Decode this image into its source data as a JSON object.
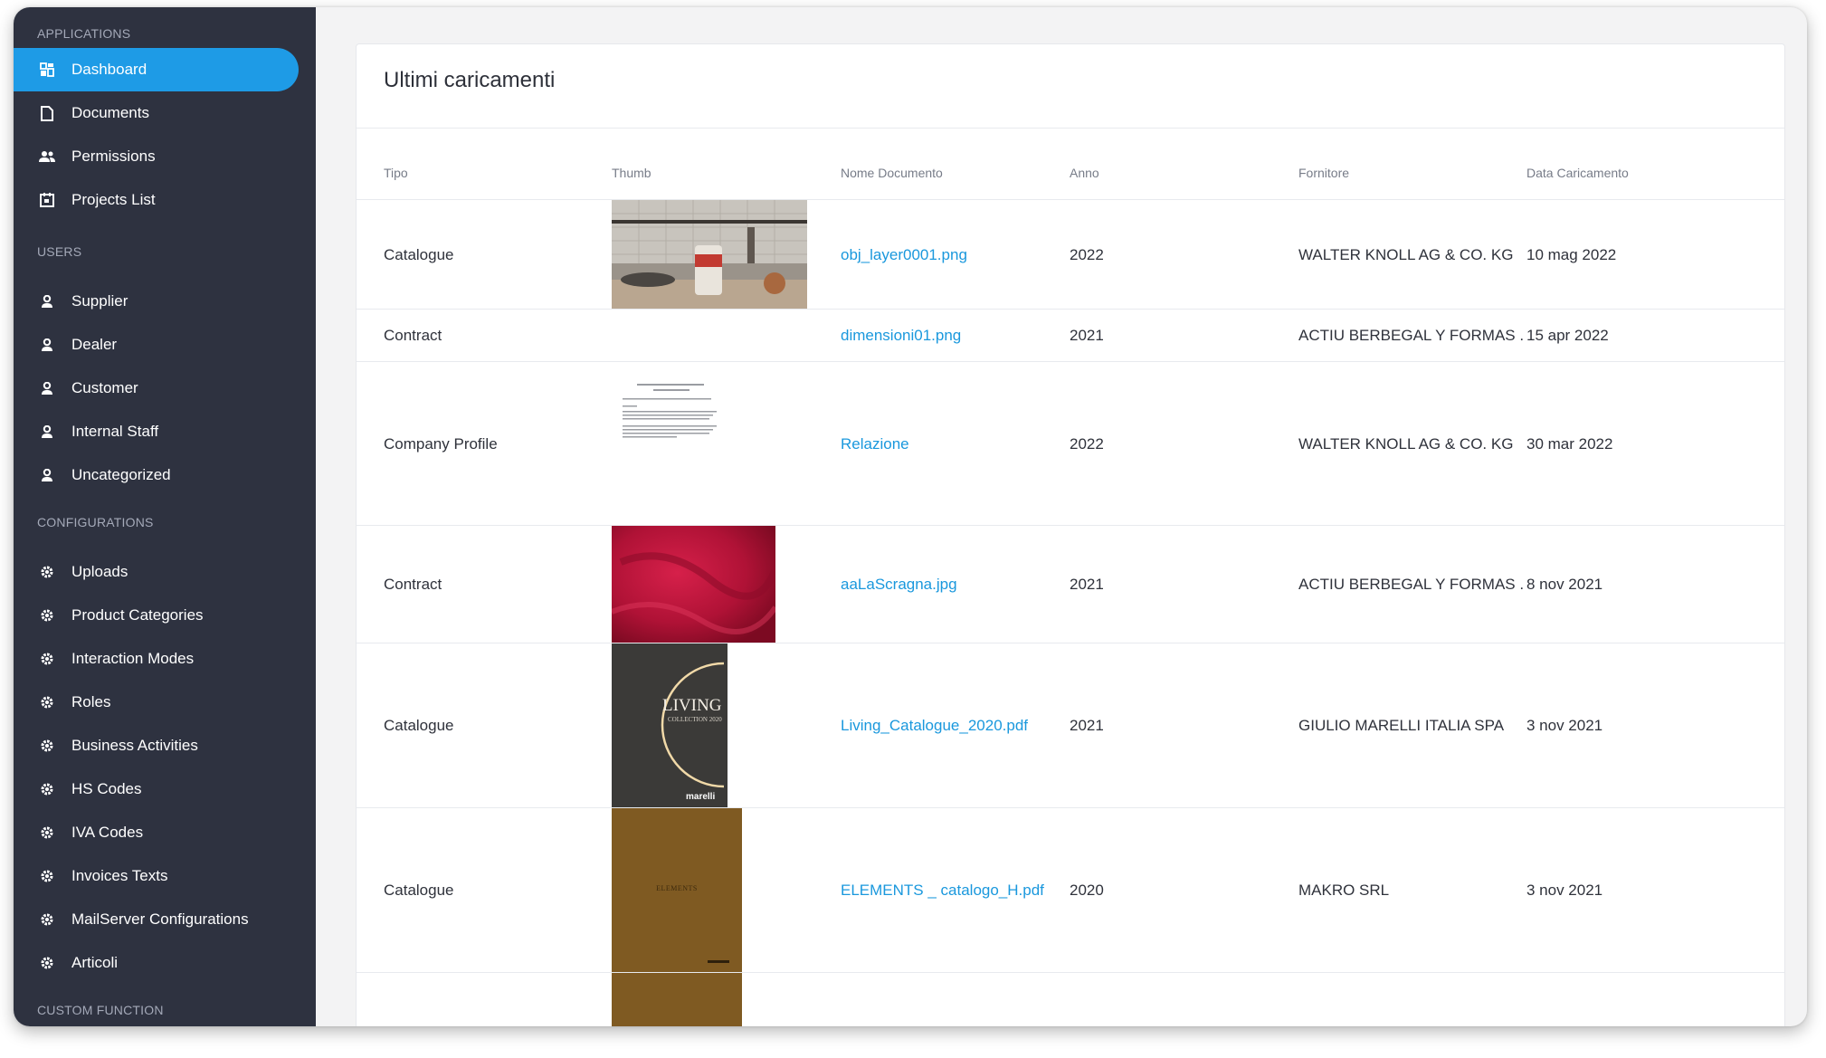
{
  "sidebar": {
    "sections": [
      {
        "title": "APPLICATIONS",
        "items": [
          {
            "label": "Dashboard",
            "icon": "dashboard-icon",
            "active": true
          },
          {
            "label": "Documents",
            "icon": "document-icon"
          },
          {
            "label": "Permissions",
            "icon": "users-icon"
          },
          {
            "label": "Projects List",
            "icon": "calendar-icon"
          }
        ]
      },
      {
        "title": "USERS",
        "items": [
          {
            "label": "Supplier",
            "icon": "user-icon"
          },
          {
            "label": "Dealer",
            "icon": "user-icon"
          },
          {
            "label": "Customer",
            "icon": "user-icon"
          },
          {
            "label": "Internal Staff",
            "icon": "user-icon"
          },
          {
            "label": "Uncategorized",
            "icon": "user-icon"
          }
        ]
      },
      {
        "title": "CONFIGURATIONS",
        "items": [
          {
            "label": "Uploads",
            "icon": "gear-icon"
          },
          {
            "label": "Product Categories",
            "icon": "gear-icon"
          },
          {
            "label": "Interaction Modes",
            "icon": "gear-icon"
          },
          {
            "label": "Roles",
            "icon": "gear-icon"
          },
          {
            "label": "Business Activities",
            "icon": "gear-icon"
          },
          {
            "label": "HS Codes",
            "icon": "gear-icon"
          },
          {
            "label": "IVA Codes",
            "icon": "gear-icon"
          },
          {
            "label": "Invoices Texts",
            "icon": "gear-icon"
          },
          {
            "label": "MailServer Configurations",
            "icon": "gear-icon"
          },
          {
            "label": "Articoli",
            "icon": "gear-icon"
          }
        ]
      },
      {
        "title": "CUSTOM FUNCTION",
        "items": []
      }
    ]
  },
  "main": {
    "title": "Ultimi caricamenti",
    "columns": [
      "Tipo",
      "Thumb",
      "Nome Documento",
      "Anno",
      "Fornitore",
      "Data Caricamento"
    ],
    "rows": [
      {
        "tipo": "Catalogue",
        "thumb": "kitchen-photo",
        "nome": "obj_layer0001.png",
        "anno": "2022",
        "fornitore": "WALTER KNOLL AG & CO. KG",
        "data": "10 mag 2022"
      },
      {
        "tipo": "Contract",
        "thumb": "",
        "nome": "dimensioni01.png",
        "anno": "2021",
        "fornitore": "ACTIU BERBEGAL Y FORMAS ...",
        "data": "15 apr 2022"
      },
      {
        "tipo": "Company Profile",
        "thumb": "document-page",
        "nome": "Relazione",
        "anno": "2022",
        "fornitore": "WALTER KNOLL AG & CO. KG",
        "data": "30 mar 2022"
      },
      {
        "tipo": "Contract",
        "thumb": "red-fabric",
        "nome": "aaLaScragna.jpg",
        "anno": "2021",
        "fornitore": "ACTIU BERBEGAL Y FORMAS ...",
        "data": "8 nov 2021"
      },
      {
        "tipo": "Catalogue",
        "thumb": "living-catalogue-cover",
        "thumb_text": "LIVING",
        "thumb_subtext": "COLLECTION 2020",
        "thumb_brand": "marelli",
        "nome": "Living_Catalogue_2020.pdf",
        "anno": "2021",
        "fornitore": "GIULIO MARELLI ITALIA SPA",
        "data": "3 nov 2021"
      },
      {
        "tipo": "Catalogue",
        "thumb": "elements-catalogue-cover",
        "thumb_text": "ELEMENTS",
        "nome": "ELEMENTS _ catalogo_H.pdf",
        "anno": "2020",
        "fornitore": "MAKRO SRL",
        "data": "3 nov 2021"
      },
      {
        "tipo": "",
        "thumb": "elements-catalogue-cover",
        "nome": "",
        "anno": "",
        "fornitore": "",
        "data": ""
      }
    ]
  },
  "colors": {
    "sidebar_bg": "#2e3240",
    "accent": "#1e9be6",
    "link": "#1a98dd",
    "content_bg": "#f3f3f4"
  }
}
